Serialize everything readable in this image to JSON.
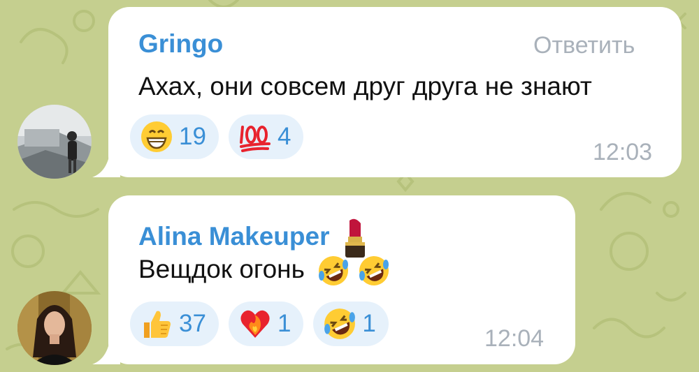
{
  "background": {
    "color": "#c5cf8f",
    "pattern_color": "#b8c47e"
  },
  "messages": [
    {
      "author": "Gringo",
      "reply_label": "Ответить",
      "text": "Ахах, они совсем друг друга не знают",
      "reactions": [
        {
          "icon": "grinning-face-icon",
          "count": "19"
        },
        {
          "icon": "hundred-points-icon",
          "count": "4"
        }
      ],
      "time": "12:03"
    },
    {
      "author": "Alina Makeuper",
      "author_badge_icon": "lipstick-icon",
      "text": "Вещдок огонь",
      "text_emojis": [
        "rolling-laughing-icon",
        "rolling-laughing-icon"
      ],
      "reactions": [
        {
          "icon": "thumbs-up-icon",
          "count": "37"
        },
        {
          "icon": "heart-on-fire-icon",
          "count": "1"
        },
        {
          "icon": "rolling-laughing-icon",
          "count": "1"
        }
      ],
      "time": "12:04"
    }
  ],
  "colors": {
    "author": "#3a8fd6",
    "reaction_bg": "#e6f1fb",
    "meta_text": "#a9b1ba"
  }
}
